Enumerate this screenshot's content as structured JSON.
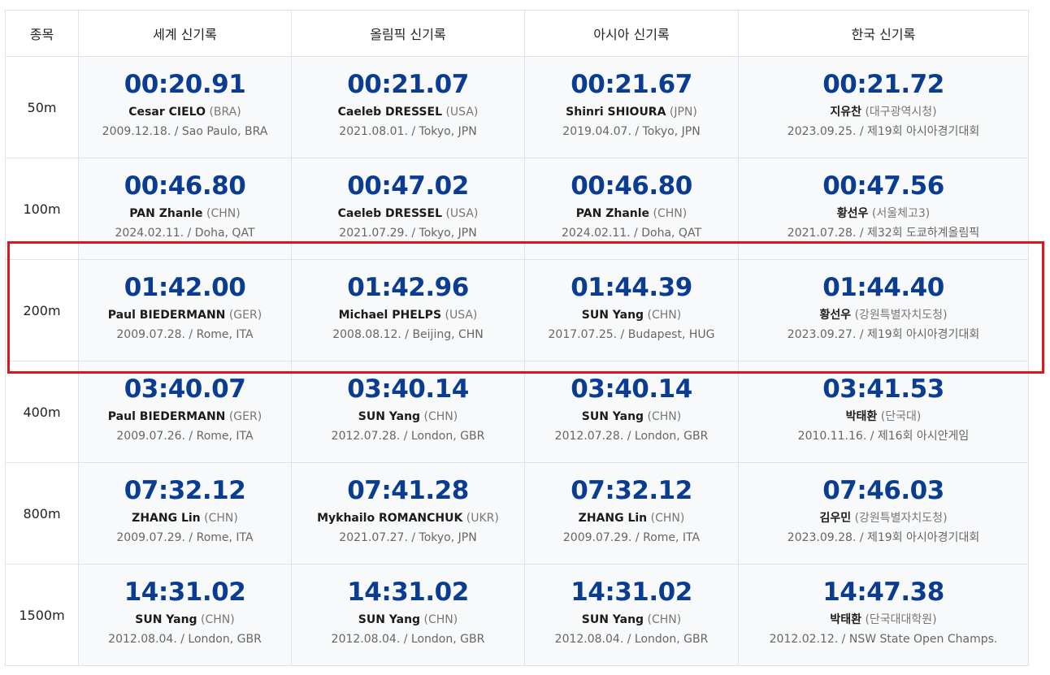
{
  "columns": [
    "종목",
    "세계 신기록",
    "올림픽 신기록",
    "아시아 신기록",
    "한국 신기록"
  ],
  "rows": [
    {
      "event": "50m",
      "records": [
        {
          "time": "00:20.91",
          "name": "Cesar CIELO",
          "country": "(BRA)",
          "date": "2009.12.18.",
          "place": "Sao Paulo, BRA"
        },
        {
          "time": "00:21.07",
          "name": "Caeleb DRESSEL",
          "country": "(USA)",
          "date": "2021.08.01.",
          "place": "Tokyo, JPN"
        },
        {
          "time": "00:21.67",
          "name": "Shinri SHIOURA",
          "country": "(JPN)",
          "date": "2019.04.07.",
          "place": "Tokyo, JPN"
        },
        {
          "time": "00:21.72",
          "name": "지유찬",
          "country": "(대구광역시청)",
          "date": "2023.09.25.",
          "place": "제19회 아시아경기대회"
        }
      ]
    },
    {
      "event": "100m",
      "records": [
        {
          "time": "00:46.80",
          "name": "PAN Zhanle",
          "country": "(CHN)",
          "date": "2024.02.11.",
          "place": "Doha, QAT"
        },
        {
          "time": "00:47.02",
          "name": "Caeleb DRESSEL",
          "country": "(USA)",
          "date": "2021.07.29.",
          "place": "Tokyo, JPN"
        },
        {
          "time": "00:46.80",
          "name": "PAN Zhanle",
          "country": "(CHN)",
          "date": "2024.02.11.",
          "place": "Doha, QAT"
        },
        {
          "time": "00:47.56",
          "name": "황선우",
          "country": "(서울체고3)",
          "date": "2021.07.28.",
          "place": "제32회 도쿄하계올림픽"
        }
      ]
    },
    {
      "event": "200m",
      "records": [
        {
          "time": "01:42.00",
          "name": "Paul BIEDERMANN",
          "country": "(GER)",
          "date": "2009.07.28.",
          "place": "Rome, ITA"
        },
        {
          "time": "01:42.96",
          "name": "Michael PHELPS",
          "country": "(USA)",
          "date": "2008.08.12.",
          "place": "Beijing, CHN"
        },
        {
          "time": "01:44.39",
          "name": "SUN Yang",
          "country": "(CHN)",
          "date": "2017.07.25.",
          "place": "Budapest, HUG"
        },
        {
          "time": "01:44.40",
          "name": "황선우",
          "country": "(강원특별자치도청)",
          "date": "2023.09.27.",
          "place": "제19회 아시아경기대회"
        }
      ]
    },
    {
      "event": "400m",
      "records": [
        {
          "time": "03:40.07",
          "name": "Paul BIEDERMANN",
          "country": "(GER)",
          "date": "2009.07.26.",
          "place": "Rome, ITA"
        },
        {
          "time": "03:40.14",
          "name": "SUN Yang",
          "country": "(CHN)",
          "date": "2012.07.28.",
          "place": "London, GBR"
        },
        {
          "time": "03:40.14",
          "name": "SUN Yang",
          "country": "(CHN)",
          "date": "2012.07.28.",
          "place": "London, GBR"
        },
        {
          "time": "03:41.53",
          "name": "박태환",
          "country": "(단국대)",
          "date": "2010.11.16.",
          "place": "제16회 아시안게임"
        }
      ]
    },
    {
      "event": "800m",
      "records": [
        {
          "time": "07:32.12",
          "name": "ZHANG Lin",
          "country": "(CHN)",
          "date": "2009.07.29.",
          "place": "Rome, ITA"
        },
        {
          "time": "07:41.28",
          "name": "Mykhailo ROMANCHUK",
          "country": "(UKR)",
          "date": "2021.07.27.",
          "place": "Tokyo, JPN"
        },
        {
          "time": "07:32.12",
          "name": "ZHANG Lin",
          "country": "(CHN)",
          "date": "2009.07.29.",
          "place": "Rome, ITA"
        },
        {
          "time": "07:46.03",
          "name": "김우민",
          "country": "(강원특별자치도청)",
          "date": "2023.09.28.",
          "place": "제19회 아시아경기대회"
        }
      ]
    },
    {
      "event": "1500m",
      "records": [
        {
          "time": "14:31.02",
          "name": "SUN Yang",
          "country": "(CHN)",
          "date": "2012.08.04.",
          "place": "London, GBR"
        },
        {
          "time": "14:31.02",
          "name": "SUN Yang",
          "country": "(CHN)",
          "date": "2012.08.04.",
          "place": "London, GBR"
        },
        {
          "time": "14:31.02",
          "name": "SUN Yang",
          "country": "(CHN)",
          "date": "2012.08.04.",
          "place": "London, GBR"
        },
        {
          "time": "14:47.38",
          "name": "박태환",
          "country": "(단국대대학원)",
          "date": "2012.02.12.",
          "place": "NSW State Open Champs."
        }
      ]
    }
  ],
  "colors": {
    "time": "#0a3d91",
    "highlight": "#e0141e",
    "cell_bg": "#f8f9fa"
  }
}
